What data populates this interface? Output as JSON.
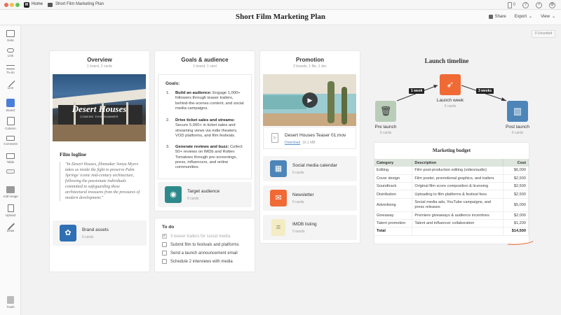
{
  "titlebar": {
    "home": "Home",
    "doc": "Short Film Marketing Plan",
    "notifications": "0"
  },
  "header": {
    "title": "Short Film Marketing Plan",
    "share": "Share",
    "export": "Export",
    "view": "View"
  },
  "toolbar": {
    "note": "Note",
    "link": "Link",
    "todo": "To-do",
    "line": "Line",
    "board": "Board",
    "column": "Column",
    "comment": "Comment",
    "table": "Table",
    "add_image": "Add image",
    "upload": "Upload",
    "draw": "Draw",
    "trash": "Trash"
  },
  "unsorted": "0 Unsorted",
  "overview": {
    "title": "Overview",
    "sub": "1 board, 2 cards",
    "hero_title": "Desert Houses",
    "hero_sub": "COMING THIS SUMMER",
    "logline_head": "Film logline",
    "logline": "\"In Desert Houses, filmmaker Sonya Myers takes us inside the fight to preserve Palm Springs' iconic mid-century architecture, following the passionate individuals committed to safeguarding these architectural treasures from the pressures of modern development.\"",
    "brand": {
      "title": "Brand assets",
      "sub": "0 cards"
    }
  },
  "goals": {
    "title": "Goals & audience",
    "sub": "1 board, 1 card",
    "head": "Goals:",
    "items": [
      {
        "num": "1.",
        "bold": "Build an audience:",
        "text": "Engage 1,000+ followers through teaser trailers, behind-the-scenes content, and social media campaigns."
      },
      {
        "num": "2.",
        "bold": "Drive ticket sales and streams:",
        "text": "Secure 5,000+ in ticket sales and streaming views via indie theaters, VOD platforms, and film festivals."
      },
      {
        "num": "3.",
        "bold": "Generate reviews and buzz:",
        "text": "Collect 50+ reviews on IMDb and Rotten Tomatoes through pre-screenings, press, influencers, and online communities."
      }
    ],
    "audience": {
      "title": "Target audience",
      "sub": "0 cards"
    }
  },
  "todo": {
    "title": "To do",
    "items": [
      {
        "text": "3 teaser trailers for social media.",
        "done": true
      },
      {
        "text": "Submit film to festivals and platforms",
        "done": false
      },
      {
        "text": "Send a launch announcement email",
        "done": false
      },
      {
        "text": "Schedule 2 interviews with media",
        "done": false
      }
    ]
  },
  "promotion": {
    "title": "Promotion",
    "sub": "2 boards, 1 file, 1 doc",
    "file": {
      "name": "Desert Houses Teaser 01.mov",
      "download": "Download",
      "size": "16.1 MB"
    },
    "social": {
      "title": "Social media calendar",
      "sub": "0 cards"
    },
    "newsletter": {
      "title": "Newsletter",
      "sub": "0 cards"
    },
    "imdb": {
      "title": "IMDB listing",
      "sub": "0 words"
    }
  },
  "timeline": {
    "title": "Launch timeline",
    "pre": {
      "label": "Pre launch",
      "sub": "0 cards"
    },
    "launch": {
      "label": "Launch week",
      "sub": "0 cards"
    },
    "post": {
      "label": "Post launch",
      "sub": "0 cards"
    },
    "arrow1": "1 week",
    "arrow2": "3 weeks"
  },
  "budget": {
    "title": "Marketing budget",
    "headers": {
      "category": "Category",
      "description": "Description",
      "cost": "Cost"
    },
    "rows": [
      {
        "category": "Editing",
        "description": "Film post-production editing (video/audio)",
        "cost": "$6,000"
      },
      {
        "category": "Cover design",
        "description": "Film poster, promotional graphics, and trailers",
        "cost": "$2,500"
      },
      {
        "category": "Soundtrack",
        "description": "Original film score composition & licensing",
        "cost": "$2,500"
      },
      {
        "category": "Distribution",
        "description": "Uploading to film platforms & festival fees",
        "cost": "$2,500"
      },
      {
        "category": "Advertising",
        "description": "Social media ads, YouTube campaigns, and",
        "description2": "press releases",
        "cost": "$5,000"
      },
      {
        "category": "Giveaway",
        "description": "Premiere giveaways & audience incentives",
        "cost": "$2,000"
      },
      {
        "category": "Talent promotion",
        "description": "Talent and influencer collaboration",
        "cost": "$1,200"
      }
    ],
    "total_label": "Total",
    "total": "$14,500"
  },
  "colors": {
    "accent_blue": "#2f6fb3",
    "teal": "#2e8a8a",
    "orange": "#f06a35",
    "sage": "#b9cdb9",
    "steel": "#4d85b8"
  }
}
